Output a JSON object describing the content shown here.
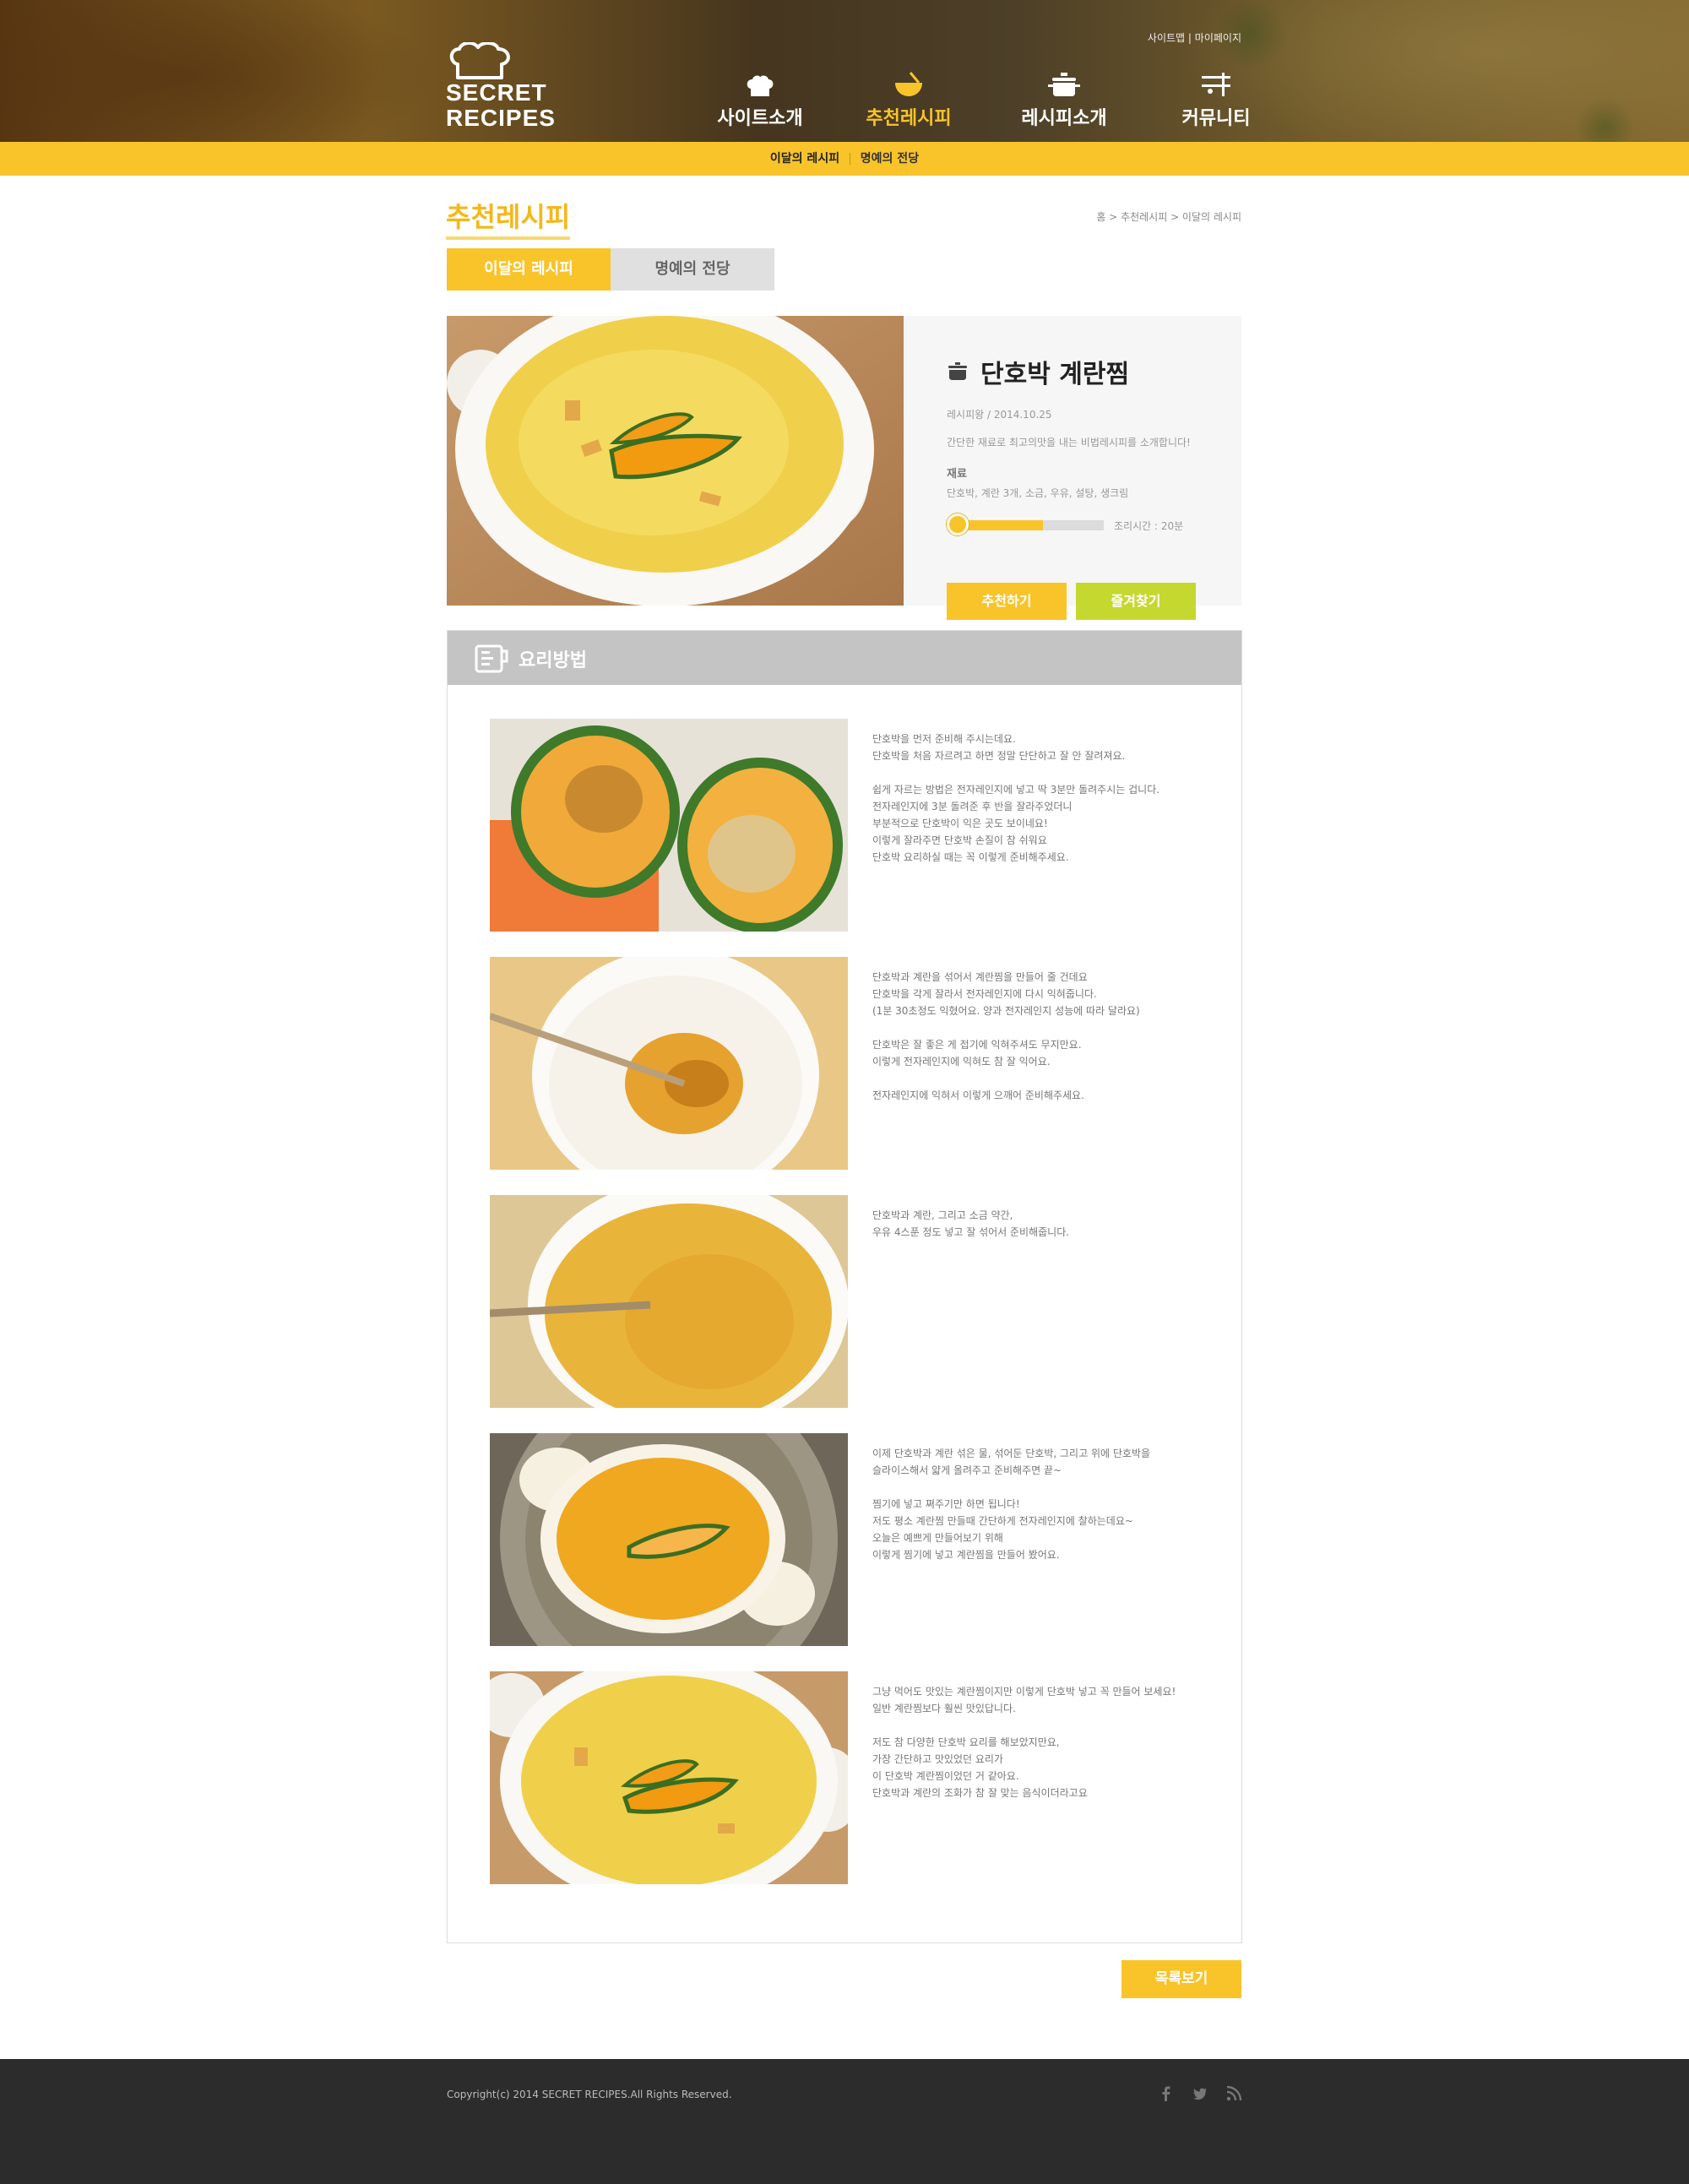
{
  "header": {
    "logo_line1": "SECRET",
    "logo_line2": "RECIPES",
    "util_sitemap": "사이트맵",
    "util_sep": "|",
    "util_mypage": "마이페이지",
    "nav": [
      {
        "label": "사이트소개",
        "icon": "chef-hat-icon"
      },
      {
        "label": "추천레시피",
        "icon": "bowl-icon",
        "active": true
      },
      {
        "label": "레시피소개",
        "icon": "pot-icon"
      },
      {
        "label": "커뮤니티",
        "icon": "utensils-icon"
      }
    ]
  },
  "subnav": {
    "item1": "이달의 레시피",
    "sep": "|",
    "item2": "명예의 전당"
  },
  "page": {
    "title": "추천레시피",
    "breadcrumb": "홈 > 추천레시피 > 이달의 레시피",
    "tabs": [
      "이달의 레시피",
      "명예의 전당"
    ]
  },
  "recipe": {
    "title": "단호박 계란찜",
    "meta": "레시피왕 / 2014.10.25",
    "description": "간단한 재료로 최고의맛을 내는 비법레시피를 소개합니다!",
    "ingredients_heading": "재료",
    "ingredients": "단호박, 계란 3개, 소금, 우유, 설탕, 생크림",
    "time_label": "조리시간 : 20분",
    "time_progress": 0.6,
    "recommend_label": "추천하기",
    "favorite_label": "즐겨찾기"
  },
  "method": {
    "heading": "요리방법",
    "steps": [
      {
        "text": "단호박을 먼저 준비해 주시는데요.\n단호박을 처음 자르려고 하면 정말 단단하고 잘 안 잘려져요.\n\n쉽게 자르는 방법은 전자레인지에 넣고 딱 3분만 돌려주시는 겁니다.\n전자레인지에 3분 돌려준 후 반을 잘라주었더니\n부분적으로 단호박이 익은 곳도 보이네요!\n이렇게 잘라주면 단호박 손질이 참 쉬워요\n단호박 요리하실 때는 꼭 이렇게 준비해주세요."
      },
      {
        "text": "단호박과 계란을 섞어서 계란찜을 만들어 줄 건데요\n단호박을 각게 잘라서 전자레인지에 다시 익혀줍니다.\n(1분 30초정도 익혔어요. 양과 전자레인지 성능에 따라 달라요)\n\n단호박은 잘 좋은 게 접기에 익혀주셔도 무지만요.\n이렇게 전자레인지에 익혀도 참 잘 익어요.\n\n전자레인지에 익혀서 이렇게 으깨어 준비해주세요."
      },
      {
        "text": "단호박과 계란, 그리고 소금 약간,\n우유 4스푼 정도 넣고 잘 섞어서 준비해줍니다."
      },
      {
        "text": "이제 단호박과 계란 섞은 물, 섞어둔 단호박, 그리고 위에 단호박을\n슬라이스해서 얇게 올려주고 준비해주면 끝~\n\n찜기에 넣고 쪄주기만 하면 됩니다!\n저도 평소 계란찜 만들때 간단하게 전자레인지에 찰하는데요~\n오늘은 예쁘게 만들어보기 위해\n이렇게 찜기에 넣고 계란찜을 만들어 봤어요."
      },
      {
        "text": "그냥 먹어도 맛있는 계란찜이지만 이렇게 단호박 넣고 꼭 만들어 보세요!\n일반 계란찜보다 훨씬 맛있답니다.\n\n저도 참 다양한 단호박 요리를 해보았지만요,\n가장 간단하고 맛있었던 요리가\n이 단호박 계란찜이었던 거 같아요.\n단호박과 계란의 조화가 참 잘 맞는 음식이더라고요"
      }
    ]
  },
  "list_button": "목록보기",
  "footer": {
    "copyright": "Copyright(c) 2014 SECRET RECIPES.All Rights Reserved.",
    "sns": [
      "facebook-icon",
      "twitter-icon",
      "rss-icon"
    ]
  },
  "colors": {
    "accent": "#f8c42a",
    "favorite": "#c5d82f",
    "footer": "#2c2c2c",
    "method_header": "#c4c4c4"
  }
}
